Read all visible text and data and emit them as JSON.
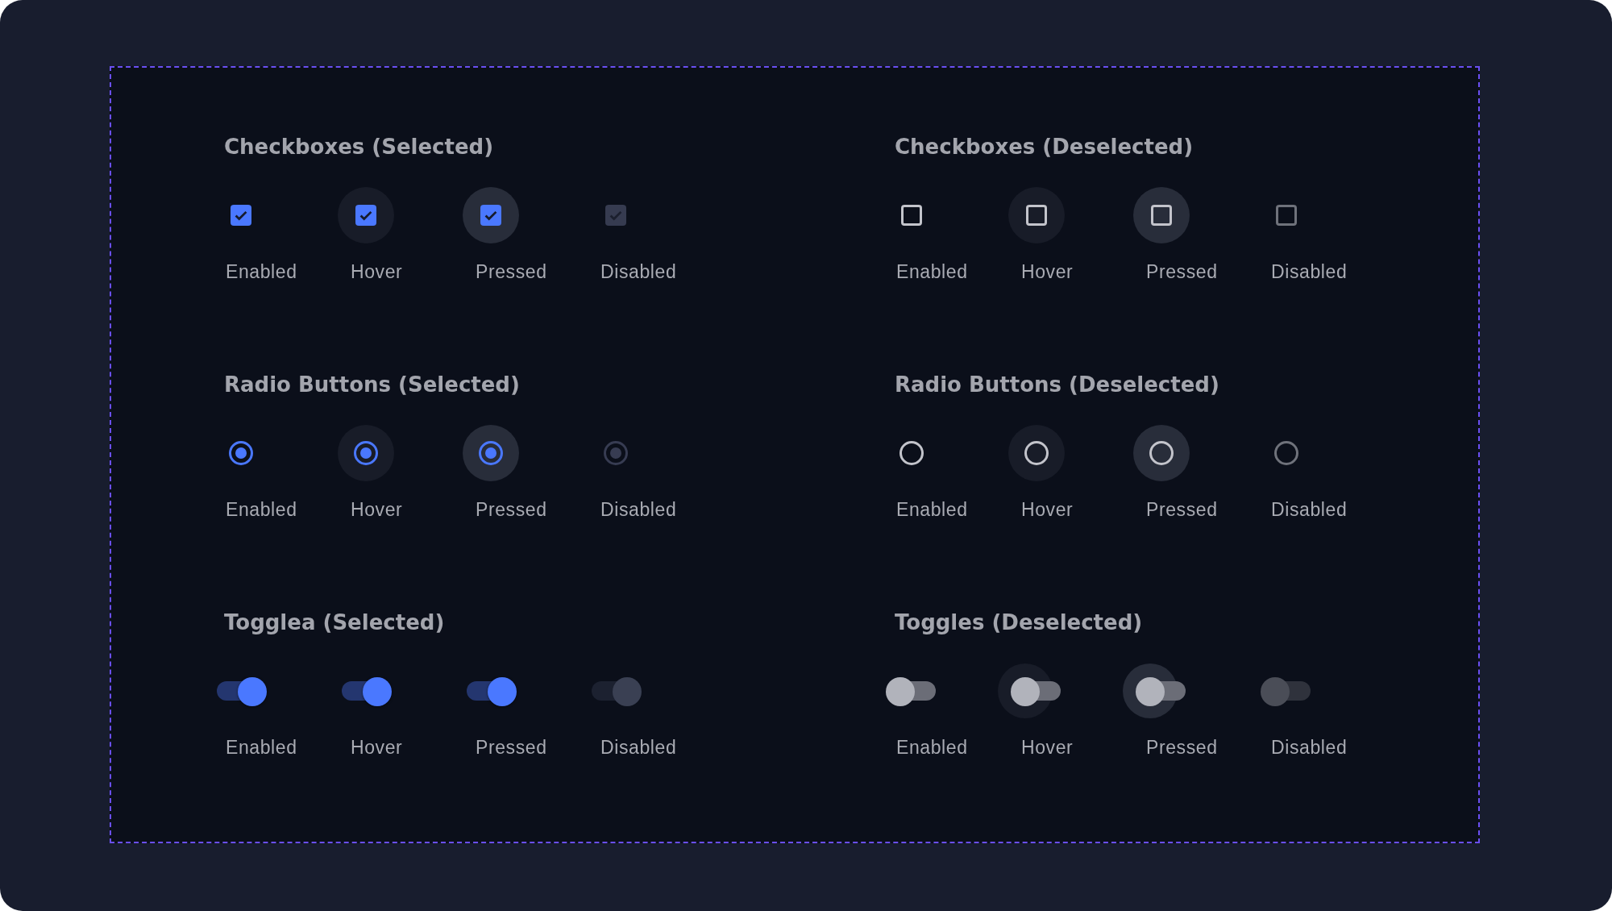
{
  "sections": [
    {
      "title": "Checkboxes (Selected)",
      "kind": "checkbox",
      "items": [
        {
          "label": "Enabled",
          "kind": "plain",
          "checked": true
        },
        {
          "label": "Hover",
          "kind": "hovered",
          "checked": true
        },
        {
          "label": "Pressed",
          "kind": "held",
          "checked": true
        },
        {
          "label": "Disabled",
          "kind": "dimmed",
          "checked": true
        }
      ]
    },
    {
      "title": "Checkboxes (Deselected)",
      "kind": "checkbox",
      "items": [
        {
          "label": "Enabled",
          "kind": "plain",
          "checked": false
        },
        {
          "label": "Hover",
          "kind": "hovered",
          "checked": false
        },
        {
          "label": "Pressed",
          "kind": "held",
          "checked": false
        },
        {
          "label": "Disabled",
          "kind": "dimmed",
          "checked": false
        }
      ]
    },
    {
      "title": "Radio Buttons (Selected)",
      "kind": "radio",
      "items": [
        {
          "label": "Enabled",
          "kind": "plain",
          "checked": true
        },
        {
          "label": "Hover",
          "kind": "hovered",
          "checked": true
        },
        {
          "label": "Pressed",
          "kind": "held",
          "checked": true
        },
        {
          "label": "Disabled",
          "kind": "dimmed",
          "checked": true
        }
      ]
    },
    {
      "title": "Radio Buttons (Deselected)",
      "kind": "radio",
      "items": [
        {
          "label": "Enabled",
          "kind": "plain",
          "checked": false
        },
        {
          "label": "Hover",
          "kind": "hovered",
          "checked": false
        },
        {
          "label": "Pressed",
          "kind": "held",
          "checked": false
        },
        {
          "label": "Disabled",
          "kind": "dimmed",
          "checked": false
        }
      ]
    },
    {
      "title": "Togglea (Selected)",
      "kind": "toggle",
      "items": [
        {
          "label": "Enabled",
          "kind": "plain",
          "checked": true
        },
        {
          "label": "Hover",
          "kind": "hovered",
          "checked": true
        },
        {
          "label": "Pressed",
          "kind": "held",
          "checked": true
        },
        {
          "label": "Disabled",
          "kind": "dimmed",
          "checked": true
        }
      ]
    },
    {
      "title": "Toggles  (Deselected)",
      "kind": "toggle",
      "items": [
        {
          "label": "Enabled",
          "kind": "plain",
          "checked": false
        },
        {
          "label": "Hover",
          "kind": "hovered",
          "checked": false
        },
        {
          "label": "Pressed",
          "kind": "held",
          "checked": false
        },
        {
          "label": "Disabled",
          "kind": "dimmed",
          "checked": false
        }
      ]
    }
  ]
}
